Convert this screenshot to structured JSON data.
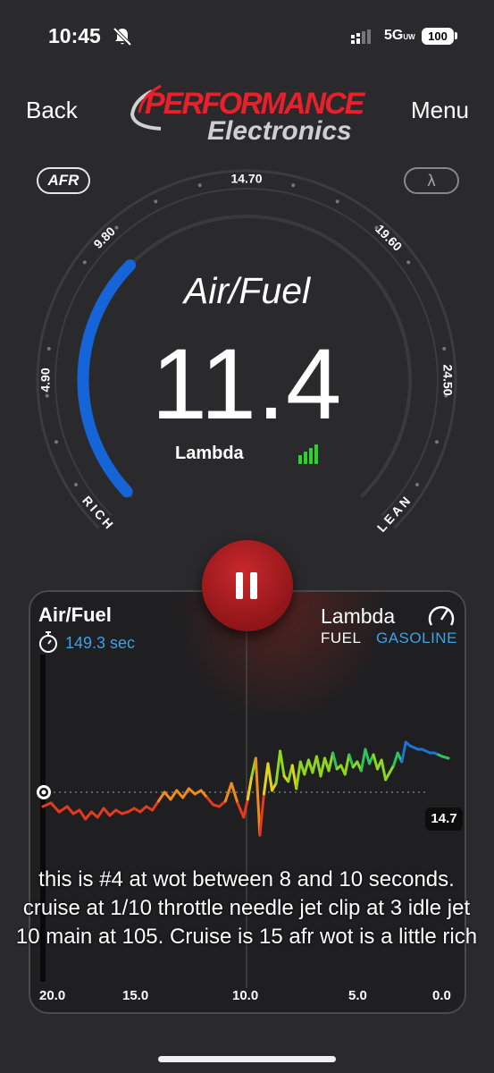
{
  "status_bar": {
    "time": "10:45",
    "network": "5G",
    "network_sub": "UW",
    "battery": "100"
  },
  "nav": {
    "back_label": "Back",
    "menu_label": "Menu"
  },
  "logo": {
    "line1": "PERFORMANCE",
    "line2": "Electronics"
  },
  "gauge": {
    "afr_pill": "AFR",
    "lambda_pill": "λ",
    "title": "Air/Fuel",
    "value": "11.4",
    "sub_label": "Lambda",
    "ticks": [
      "4.90",
      "9.80",
      "14.70",
      "19.60",
      "24.50"
    ],
    "rich_label": "RICH",
    "lean_label": "LEAN",
    "range_min": 4.9,
    "range_max": 24.5,
    "current": 11.4,
    "accent_color": "#1565d8"
  },
  "pause_button": {
    "label": "pause"
  },
  "chart_panel": {
    "title": "Air/Fuel",
    "elapsed": "149.3 sec",
    "lambda_label": "Lambda",
    "fuel_label": "FUEL",
    "fuel_value": "GASOLINE",
    "reference_value": "14.7",
    "caption": "this is #4 at wot between 8 and 10 seconds. cruise at 1/10 throttle needle jet clip at 3 idle jet 10 main at 105. Cruise is 15 afr wot is a little rich"
  },
  "chart_data": {
    "type": "line",
    "x_ticks": [
      "20.0",
      "15.0",
      "10.0",
      "5.0",
      "0.0"
    ],
    "xlim": [
      20.0,
      0.0
    ],
    "reference_line": 14.7,
    "series": [
      {
        "x": [
          20.0,
          19.6,
          19.2,
          18.8,
          18.5,
          18.2,
          17.9,
          17.6,
          17.3,
          17.0,
          16.7,
          16.4,
          16.1,
          15.8,
          15.5,
          15.2,
          14.9,
          14.6,
          14.3,
          14.0,
          13.7,
          13.4,
          13.1,
          12.8,
          12.5,
          12.2,
          11.9,
          11.6,
          11.3,
          11.0,
          10.7,
          10.4,
          10.1,
          9.9,
          9.7,
          9.5,
          9.3,
          9.1,
          8.9,
          8.7,
          8.5,
          8.3,
          8.1,
          7.9,
          7.7,
          7.5,
          7.3,
          7.1,
          6.9,
          6.7,
          6.5,
          6.3,
          6.1,
          5.9,
          5.7,
          5.5,
          5.3,
          5.1,
          4.9,
          4.7,
          4.5,
          4.3,
          4.1,
          3.9,
          3.7,
          3.5,
          3.3,
          3.1,
          2.9,
          2.7,
          2.5,
          2.3,
          2.1,
          1.9,
          1.7,
          1.5,
          1.3,
          1.1,
          0.9,
          0.7,
          0.5,
          0.3,
          0.0
        ],
        "y": [
          13.9,
          14.1,
          13.6,
          13.9,
          13.5,
          13.7,
          13.2,
          13.6,
          13.3,
          13.8,
          13.4,
          13.7,
          13.5,
          13.6,
          13.8,
          13.6,
          13.9,
          13.7,
          14.2,
          14.7,
          14.3,
          14.8,
          14.4,
          14.9,
          14.6,
          14.8,
          14.4,
          14.0,
          13.9,
          14.2,
          15.2,
          14.1,
          13.3,
          14.3,
          15.6,
          16.6,
          12.3,
          14.6,
          16.3,
          14.8,
          15.2,
          17.0,
          15.6,
          15.3,
          16.2,
          14.9,
          16.4,
          15.7,
          16.5,
          15.8,
          16.7,
          15.6,
          16.6,
          15.9,
          16.9,
          16.0,
          16.2,
          15.7,
          16.8,
          16.1,
          16.4,
          15.9,
          17.1,
          16.3,
          16.8,
          16.0,
          16.5,
          15.4,
          15.8,
          16.2,
          16.9,
          16.4,
          17.5,
          17.3,
          17.2,
          17.1,
          17.1,
          17.0,
          16.9,
          16.9,
          16.8,
          16.7,
          16.6
        ]
      }
    ]
  }
}
